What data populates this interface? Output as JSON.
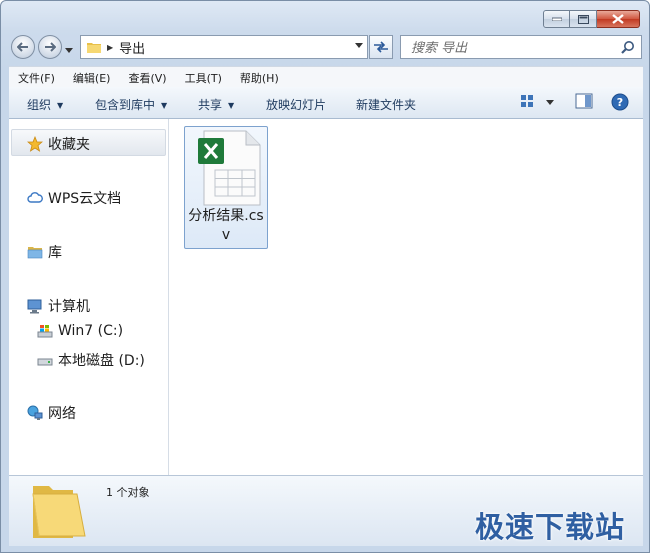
{
  "window": {
    "caption_buttons": [
      "minimize",
      "maximize",
      "close"
    ]
  },
  "address_bar": {
    "crumbs": [
      "导出"
    ]
  },
  "search": {
    "placeholder": "搜索 导出"
  },
  "menubar": {
    "items": [
      "文件(F)",
      "编辑(E)",
      "查看(V)",
      "工具(T)",
      "帮助(H)"
    ]
  },
  "commandbar": {
    "organize": "组织",
    "include_in_library": "包含到库中",
    "share": "共享",
    "slideshow": "放映幻灯片",
    "new_folder": "新建文件夹"
  },
  "nav_pane": {
    "favorites": "收藏夹",
    "wps_cloud": "WPS云文档",
    "libraries": "库",
    "computer": "计算机",
    "drive_c": "Win7 (C:)",
    "drive_d": "本地磁盘 (D:)",
    "network": "网络"
  },
  "files": [
    {
      "name": "分析结果.csv",
      "icon": "excel-csv-icon"
    }
  ],
  "details_pane": {
    "item_count": "1 个对象"
  },
  "watermark": "极速下载站",
  "colors": {
    "excel_green": "#1f7a3a",
    "watermark_blue": "#2f5fa2"
  }
}
